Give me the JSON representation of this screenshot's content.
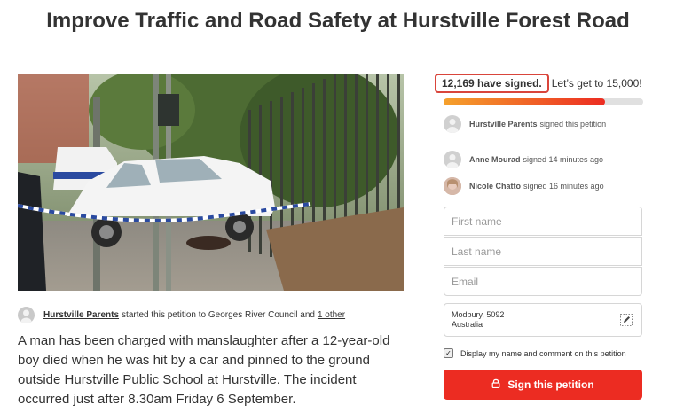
{
  "page": {
    "title": "Improve Traffic and Road Safety at Hurstville Forest Road"
  },
  "starter": {
    "name": "Hurstville Parents",
    "text": "started this petition to Georges River Council and",
    "other": "1 other"
  },
  "description": "A man has been charged with manslaughter after a 12-year-old boy died when he was hit by a car and pinned to the ground outside Hurstville Public School at Hurstville. The incident occurred just after 8.30am Friday 6 September.",
  "signatures": {
    "count_text": "12,169 have signed.",
    "goal_text": "Let’s get to 15,000!",
    "progress_fraction": 0.81
  },
  "recent_signers": [
    {
      "name": "Hurstville Parents",
      "action": "signed this petition"
    },
    {
      "name": "Anne Mourad",
      "action": "signed 14 minutes ago"
    },
    {
      "name": "Nicole Chatto",
      "action": "signed 16 minutes ago"
    }
  ],
  "form": {
    "first_name_placeholder": "First name",
    "last_name_placeholder": "Last name",
    "email_placeholder": "Email",
    "location_line1": "Modbury, 5092",
    "location_line2": "Australia",
    "display_checkbox_label": "Display my name and comment on this petition",
    "display_checked": true,
    "sign_button_label": "Sign this petition"
  },
  "icons": {
    "lock": "lock-icon",
    "edit": "pencil-icon",
    "check": "checkmark-icon"
  },
  "colors": {
    "accent_red": "#ec2c22",
    "progress_start": "#f5a12c",
    "highlight_border": "#d9453b"
  }
}
